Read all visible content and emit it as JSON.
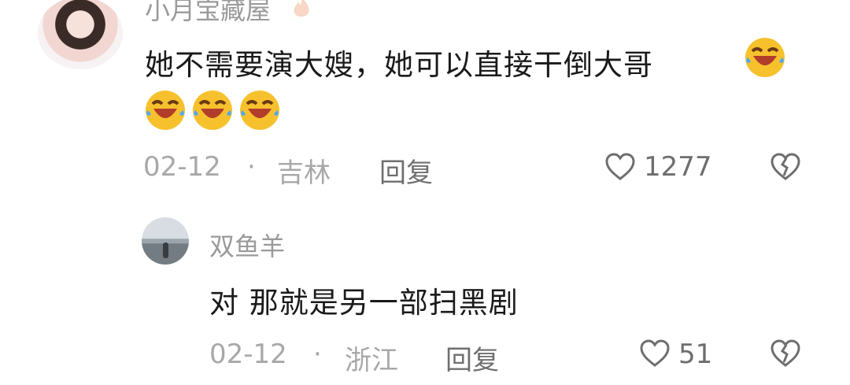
{
  "comments": [
    {
      "user": "小月宝藏屋",
      "text": "她不需要演大嫂，她可以直接干倒大哥",
      "date": "02-12",
      "location": "吉林",
      "reply_label": "回复",
      "likes": "1277",
      "emoji_icons": [
        "laugh-cry-emoji",
        "laugh-cry-emoji",
        "laugh-cry-emoji",
        "laugh-cry-emoji"
      ]
    },
    {
      "user": "双鱼羊",
      "text": "对 那就是另一部扫黑剧",
      "date": "02-12",
      "location": "浙江",
      "reply_label": "回复",
      "likes": "51"
    }
  ],
  "icons": {
    "like": "heart-outline-icon",
    "dislike": "broken-heart-icon",
    "fire": "fire-icon"
  },
  "colors": {
    "username": "#9a9a9a",
    "text": "#1a1a1a",
    "meta": "#a8a8a8",
    "emoji_yellow": "#f7c12e"
  },
  "separator": "·"
}
